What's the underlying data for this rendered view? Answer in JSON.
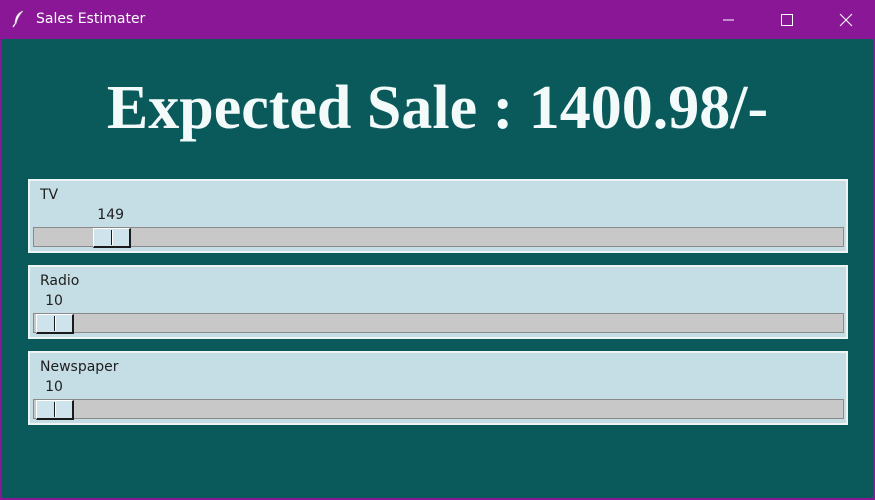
{
  "window": {
    "title": "Sales Estimater",
    "app_icon": "feather-icon",
    "controls": [
      "minimize-icon",
      "maximize-icon",
      "close-icon"
    ],
    "titlebar_color": "#8a1896",
    "background_color": "#0a5a5c"
  },
  "headline": {
    "text": "Expected Sale : 1400.98/-"
  },
  "sliders": [
    {
      "label": "TV",
      "value": "149",
      "fraction": 0.0735
    },
    {
      "label": "Radio",
      "value": "10",
      "fraction": 0.0
    },
    {
      "label": "Newspaper",
      "value": "10",
      "fraction": 0.0
    }
  ],
  "colors": {
    "panel": "#c5dde5",
    "trough": "#c8c8c8",
    "headline_text": "#f2fafa"
  }
}
